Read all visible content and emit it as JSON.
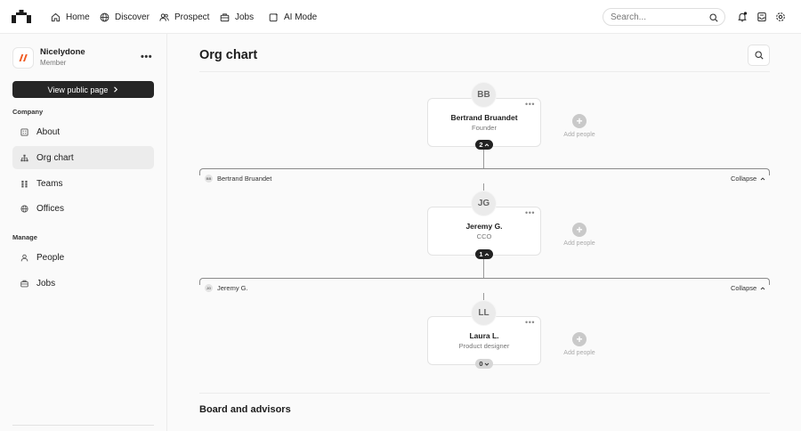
{
  "topnav": {
    "home": "Home",
    "discover": "Discover",
    "prospect": "Prospect",
    "jobs": "Jobs",
    "ai_mode": "AI Mode",
    "search_placeholder": "Search..."
  },
  "sidebar": {
    "company_name": "Nicelydone",
    "company_role": "Member",
    "more": "•••",
    "public_button": "View public page",
    "section_company": "Company",
    "section_manage": "Manage",
    "company_items": [
      "About",
      "Org chart",
      "Teams",
      "Offices"
    ],
    "manage_items": [
      "People",
      "Jobs"
    ]
  },
  "main": {
    "title": "Org chart",
    "board_title": "Board and advisors",
    "add_people": "Add people",
    "collapse": "Collapse",
    "card_more": "•••",
    "people": [
      {
        "initials": "BB",
        "name": "Bertrand Bruandet",
        "role": "Founder",
        "reports": "2",
        "state": "expanded"
      },
      {
        "initials": "JG",
        "name": "Jeremy G.",
        "role": "CCO",
        "reports": "1",
        "state": "expanded"
      },
      {
        "initials": "LL",
        "name": "Laura L.",
        "role": "Product designer",
        "reports": "0",
        "state": "collapsed"
      }
    ]
  },
  "colors": {
    "accent": "#f05a22",
    "dark": "#262626",
    "active_bg": "#ececec"
  },
  "icons": {
    "logo": "logo-icon",
    "home": "home-icon",
    "discover": "globe-icon",
    "prospect": "users-icon",
    "jobs": "briefcase-icon",
    "ai_mode": "sparkle-icon",
    "search": "search-icon",
    "notifications": "bell-icon",
    "inbox": "inbox-icon",
    "settings": "gear-icon"
  }
}
